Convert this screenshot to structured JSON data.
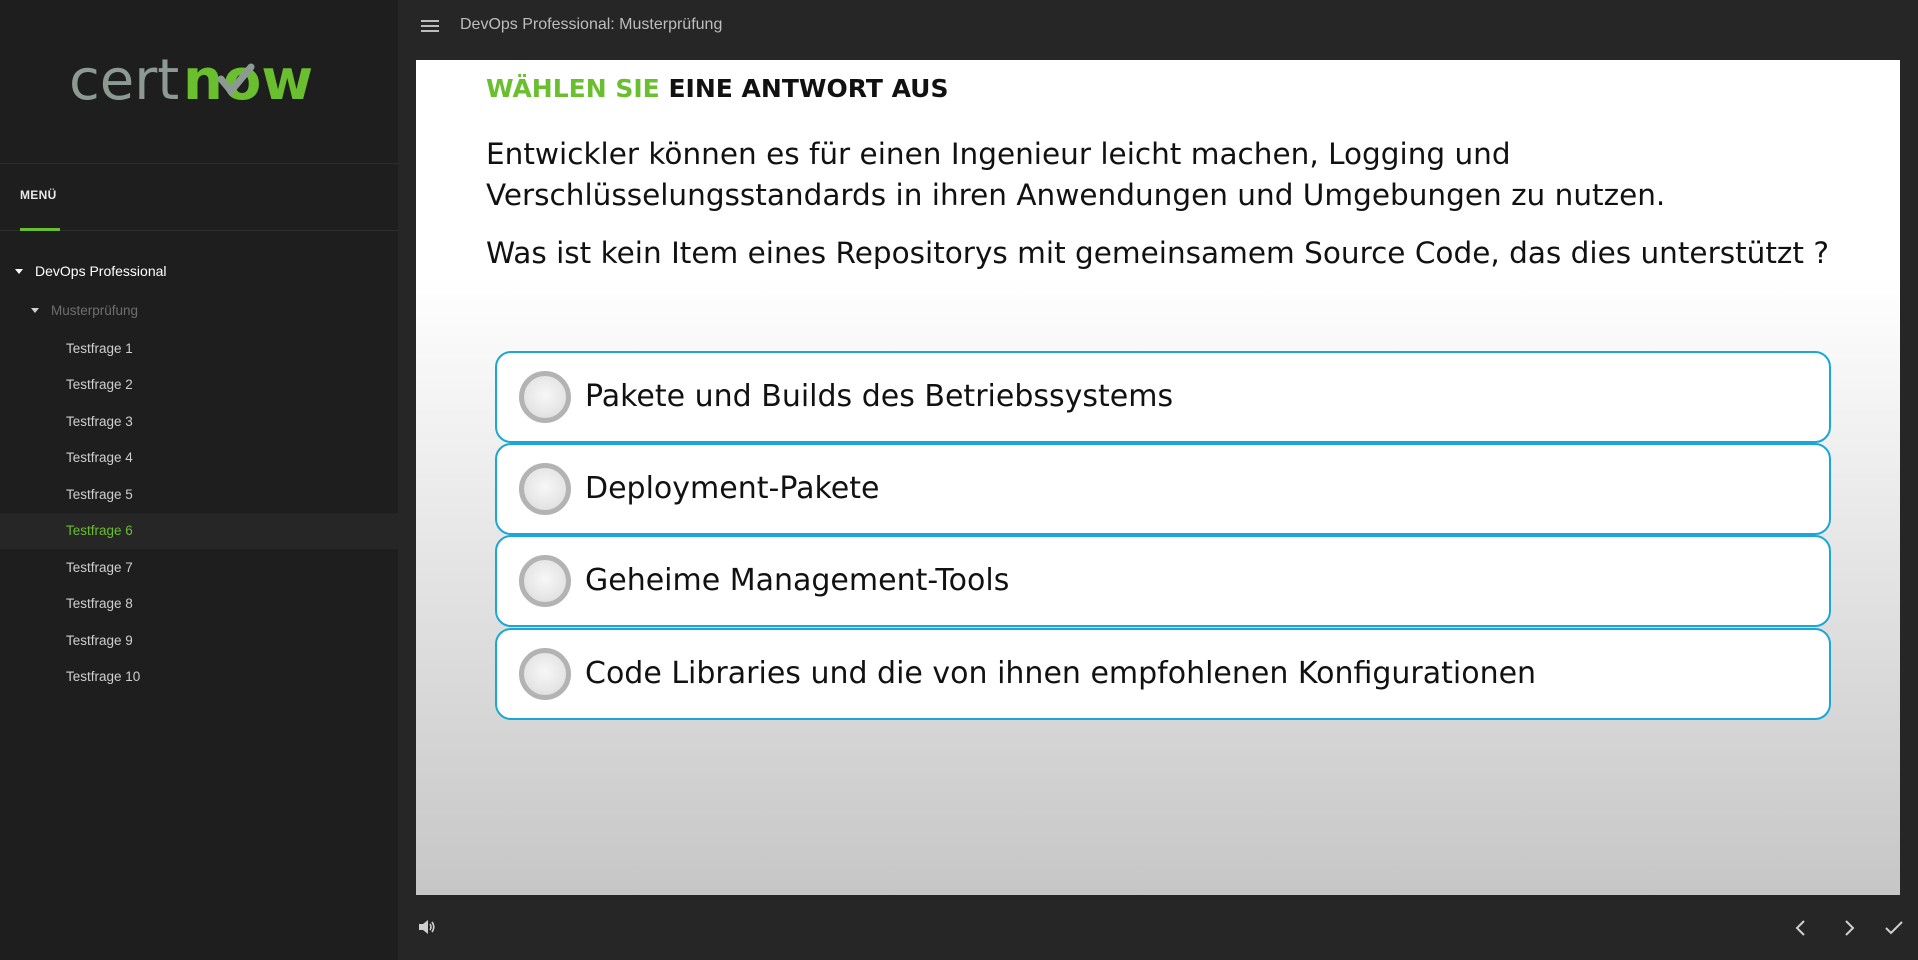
{
  "logo": {
    "text_left": "cert",
    "text_right": "now"
  },
  "sidebar": {
    "menu_tab": "MENÜ",
    "course": "DevOps Professional",
    "section": "Musterprüfung",
    "items": [
      {
        "label": "Testfrage 1"
      },
      {
        "label": "Testfrage 2"
      },
      {
        "label": "Testfrage 3"
      },
      {
        "label": "Testfrage 4"
      },
      {
        "label": "Testfrage 5"
      },
      {
        "label": "Testfrage 6",
        "active": true
      },
      {
        "label": "Testfrage 7"
      },
      {
        "label": "Testfrage 8"
      },
      {
        "label": "Testfrage 9"
      },
      {
        "label": "Testfrage 10"
      }
    ]
  },
  "header": {
    "title": "DevOps Professional: Musterprüfung"
  },
  "slide": {
    "instruction_green": "WÄHLEN SIE",
    "instruction_rest": "EINE ANTWORT AUS",
    "question_1": "Entwickler können es für einen Ingenieur leicht machen, Logging und Verschlüsselungsstandards in ihren Anwendungen und Umgebungen zu nutzen.",
    "question_2": "Was ist kein Item eines Repositorys mit gemeinsamem Source Code, das dies unterstützt ?",
    "options": [
      {
        "label": "Pakete und Builds des Betriebssystems"
      },
      {
        "label": "Deployment-Pakete"
      },
      {
        "label": "Geheime Management-Tools"
      },
      {
        "label": "Code Libraries und die von ihnen empfohlenen Konfigurationen"
      }
    ]
  },
  "colors": {
    "accent": "#6abf2e",
    "option_border": "#1ba7d6",
    "sidebar_bg": "#1e1e1e",
    "bar_bg": "#262626"
  },
  "icons": {
    "menu": "hamburger-icon",
    "volume": "volume-icon",
    "prev": "chevron-left-icon",
    "next": "chevron-right-icon",
    "submit": "checkmark-icon"
  }
}
